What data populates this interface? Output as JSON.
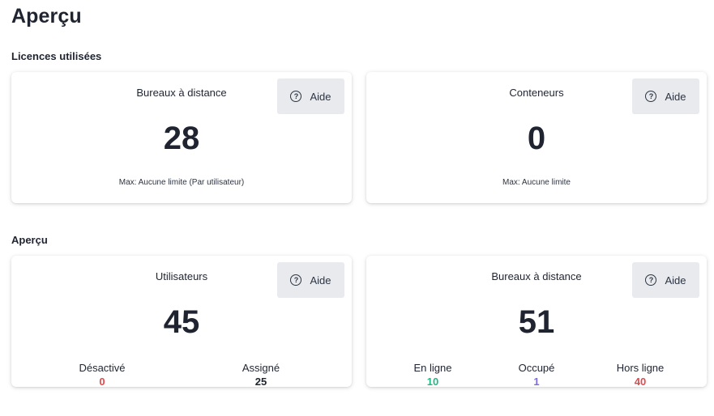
{
  "page": {
    "title": "Aperçu"
  },
  "sections": {
    "licenses": {
      "title": "Licences utilisées",
      "cards": [
        {
          "title": "Bureaux à distance",
          "help_label": "Aide",
          "value": "28",
          "note": "Max: Aucune limite (Par utilisateur)"
        },
        {
          "title": "Conteneurs",
          "help_label": "Aide",
          "value": "0",
          "note": "Max: Aucune limite"
        }
      ]
    },
    "overview": {
      "title": "Aperçu",
      "cards": [
        {
          "title": "Utilisateurs",
          "help_label": "Aide",
          "value": "45",
          "stats": [
            {
              "label": "Désactivé",
              "value": "0",
              "color": "#e5484d"
            },
            {
              "label": "Assigné",
              "value": "25",
              "color": "#1f2430"
            }
          ]
        },
        {
          "title": "Bureaux à distance",
          "help_label": "Aide",
          "value": "51",
          "stats": [
            {
              "label": "En ligne",
              "value": "10",
              "color": "#20b883"
            },
            {
              "label": "Occupé",
              "value": "1",
              "color": "#7c6ce0"
            },
            {
              "label": "Hors ligne",
              "value": "40",
              "color": "#e5484d"
            }
          ]
        }
      ]
    }
  },
  "icons": {
    "help": "question-circle-icon",
    "help_glyph": "?"
  }
}
